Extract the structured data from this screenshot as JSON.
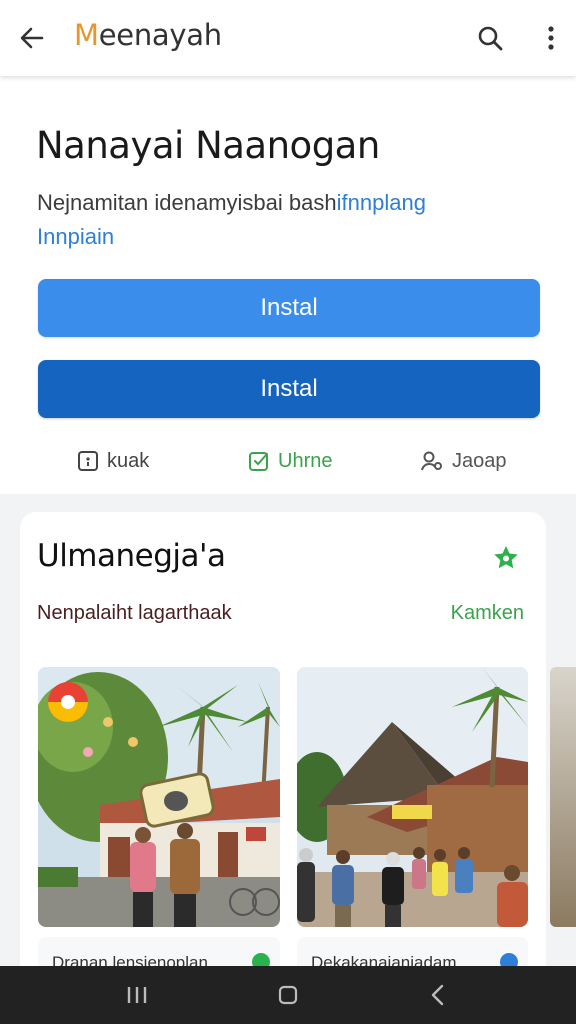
{
  "app_bar": {
    "title_first_letter": "M",
    "title_rest": "eenayah",
    "back_icon": "arrow-back-icon",
    "search_icon": "search-icon",
    "menu_icon": "more-vert-icon"
  },
  "app": {
    "name": "Nanayai Naanogan",
    "description_main": "Nejnamitan idenamyisbai bash",
    "description_link_a": "ifnnplang",
    "description_link_b": "Innpiain"
  },
  "buttons": {
    "primary_label": "Instal",
    "secondary_label": "Instal"
  },
  "actions": [
    {
      "label": "kuak",
      "icon": "info-box-icon"
    },
    {
      "label": "Uhrne",
      "icon": "edit-check-icon"
    },
    {
      "label": "Jaoap",
      "icon": "share-people-icon"
    }
  ],
  "section": {
    "title": "Ulmanegja'a",
    "subtitle": "Nenpalaiht lagarthaak",
    "link": "Kamken",
    "star_icon": "star-icon",
    "items": [
      {
        "label": "Dranan lensienoplan",
        "badge_color": "#2bb24c"
      },
      {
        "label": "Dekakanaianjadam",
        "badge_color": "#2f7ed8"
      }
    ]
  },
  "colors": {
    "accent_blue": "#3a8dea",
    "dark_blue": "#1565c0",
    "green": "#3aa34a",
    "title_orange": "#e8952b"
  },
  "nav": {
    "recents_icon": "recents-icon",
    "home_icon": "home-icon",
    "back_icon": "nav-back-icon"
  }
}
